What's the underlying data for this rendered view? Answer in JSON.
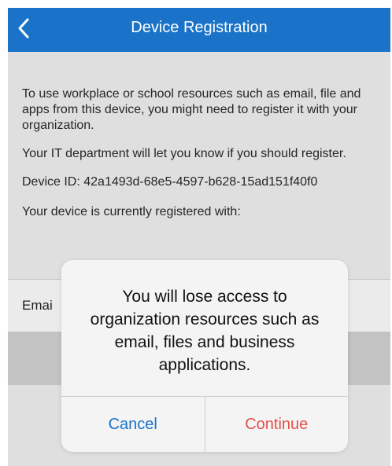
{
  "header": {
    "title": "Device Registration",
    "back_icon": "chevron-left-icon",
    "bar_color": "#1a73c8"
  },
  "content": {
    "intro": "To use workplace or school resources such as email, file and apps from this device, you might need to register it with your organization.",
    "it_notice": "Your IT department will let you know if you should register.",
    "device_id": "Device ID: 42a1493d-68e5-4597-b628-15ad151f40f0",
    "registered_with": "Your device is currently registered with:",
    "account_label": "Emai"
  },
  "alert": {
    "message": "You will lose access to organization resources such as email, files and business applications.",
    "cancel_label": "Cancel",
    "continue_label": "Continue",
    "cancel_color": "#1a73c8",
    "continue_color": "#e0524a"
  }
}
